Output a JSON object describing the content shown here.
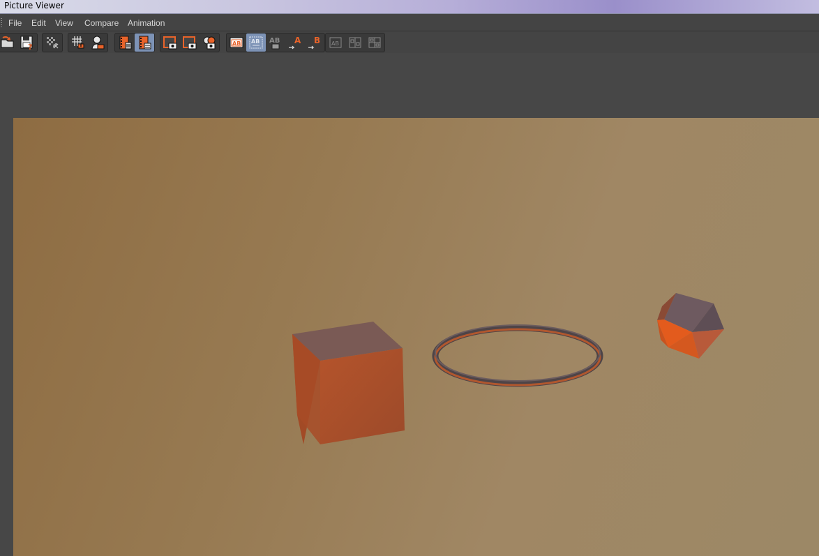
{
  "window": {
    "title": "Picture Viewer"
  },
  "menu": {
    "items": [
      {
        "label": "File"
      },
      {
        "label": "Edit"
      },
      {
        "label": "View"
      },
      {
        "label": "Compare"
      },
      {
        "label": "Animation"
      }
    ]
  },
  "toolbar": {
    "groups": [
      {
        "buttons": [
          {
            "icon": "open-file-icon"
          },
          {
            "icon": "save-as-icon"
          }
        ]
      },
      {
        "buttons": [
          {
            "icon": "transparency-grid-icon"
          }
        ]
      },
      {
        "buttons": [
          {
            "icon": "render-region-icon"
          },
          {
            "icon": "render-user-icon"
          }
        ]
      },
      {
        "buttons": [
          {
            "icon": "film-strip-delete-icon"
          },
          {
            "icon": "film-strip-info-icon",
            "active": true
          }
        ]
      },
      {
        "buttons": [
          {
            "icon": "snapshot-a-icon"
          },
          {
            "icon": "snapshot-b-icon"
          },
          {
            "icon": "snapshot-compare-icon"
          }
        ]
      },
      {
        "buttons": [
          {
            "icon": "ab-compare-icon"
          },
          {
            "icon": "ab-split-icon",
            "active": true
          },
          {
            "icon": "ab-toggle-icon"
          },
          {
            "icon": "set-a-icon",
            "text": "A"
          },
          {
            "icon": "set-b-icon",
            "text": "B"
          }
        ]
      },
      {
        "buttons": [
          {
            "icon": "ab-view-icon"
          },
          {
            "icon": "ab-side-by-side-icon"
          },
          {
            "icon": "ab-quad-icon"
          }
        ]
      }
    ]
  },
  "viewport": {
    "background_colors": [
      "#8e6c42",
      "#a08764"
    ],
    "objects": [
      {
        "name": "cube",
        "color": "#b5542b"
      },
      {
        "name": "torus",
        "color": "#c35a2a"
      },
      {
        "name": "icosahedron",
        "color": "#e35b1d"
      }
    ]
  }
}
